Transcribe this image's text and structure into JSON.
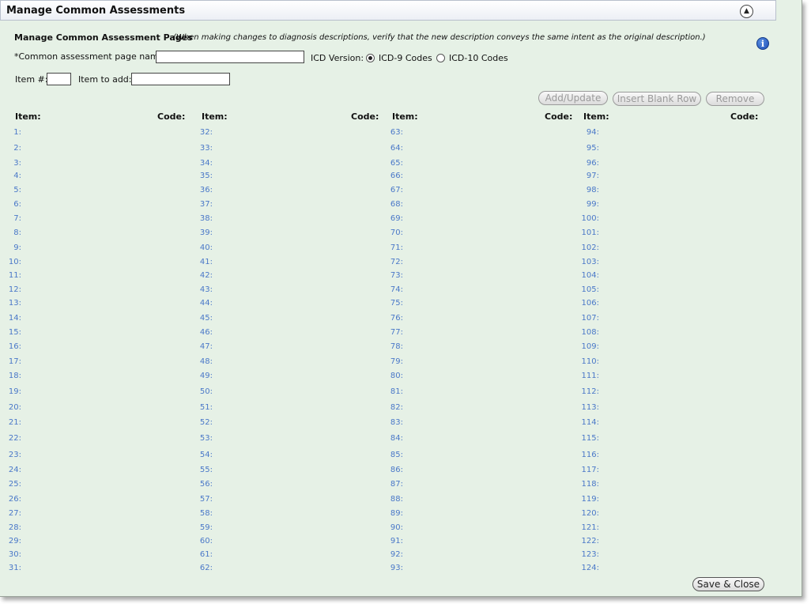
{
  "window": {
    "title": "Manage Common Assessments",
    "collapse_icon": "chevron-up-icon"
  },
  "section": {
    "title": "Manage Common Assessment Pages",
    "note": "(When making changes to diagnosis descriptions, verify that the new description conveys the same intent as the original description.)",
    "info_icon": "info-icon"
  },
  "form": {
    "page_name_label": "*Common assessment page name:",
    "page_name_value": "",
    "icd_label": "ICD Version:",
    "icd9_label": "ICD-9 Codes",
    "icd10_label": "ICD-10 Codes",
    "icd_selected": "ICD-9 Codes",
    "item_num_label": "Item #:",
    "item_num_value": "",
    "item_add_label": "Item to add:",
    "item_add_value": ""
  },
  "buttons": {
    "add_update": "Add/Update",
    "insert_blank": "Insert Blank Row",
    "remove": "Remove",
    "save_close": "Save & Close"
  },
  "table": {
    "columns": [
      {
        "item_header": "Item:",
        "code_header": "Code:",
        "items": [
          "1:",
          "2:",
          "3:",
          "4:",
          "5:",
          "6:",
          "7:",
          "8:",
          "9:",
          "10:",
          "11:",
          "12:",
          "13:",
          "14:",
          "15:",
          "16:",
          "17:",
          "18:",
          "19:",
          "20:",
          "21:",
          "22:",
          "23:",
          "24:",
          "25:",
          "26:",
          "27:",
          "28:",
          "29:",
          "30:",
          "31:"
        ]
      },
      {
        "item_header": "Item:",
        "code_header": "Code:",
        "items": [
          "32:",
          "33:",
          "34:",
          "35:",
          "36:",
          "37:",
          "38:",
          "39:",
          "40:",
          "41:",
          "42:",
          "43:",
          "44:",
          "45:",
          "46:",
          "47:",
          "48:",
          "49:",
          "50:",
          "51:",
          "52:",
          "53:",
          "54:",
          "55:",
          "56:",
          "57:",
          "58:",
          "59:",
          "60:",
          "61:",
          "62:"
        ]
      },
      {
        "item_header": "Item:",
        "code_header": "Code:",
        "items": [
          "63:",
          "64:",
          "65:",
          "66:",
          "67:",
          "68:",
          "69:",
          "70:",
          "71:",
          "72:",
          "73:",
          "74:",
          "75:",
          "76:",
          "77:",
          "78:",
          "79:",
          "80:",
          "81:",
          "82:",
          "83:",
          "84:",
          "85:",
          "86:",
          "87:",
          "88:",
          "89:",
          "90:",
          "91:",
          "92:",
          "93:"
        ]
      },
      {
        "item_header": "Item:",
        "code_header": "Code:",
        "items": [
          "94:",
          "95:",
          "96:",
          "97:",
          "98:",
          "99:",
          "100:",
          "101:",
          "102:",
          "103:",
          "104:",
          "105:",
          "106:",
          "107:",
          "108:",
          "109:",
          "110:",
          "111:",
          "112:",
          "113:",
          "114:",
          "115:",
          "116:",
          "117:",
          "118:",
          "119:",
          "120:",
          "121:",
          "122:",
          "123:",
          "124:"
        ]
      }
    ]
  }
}
